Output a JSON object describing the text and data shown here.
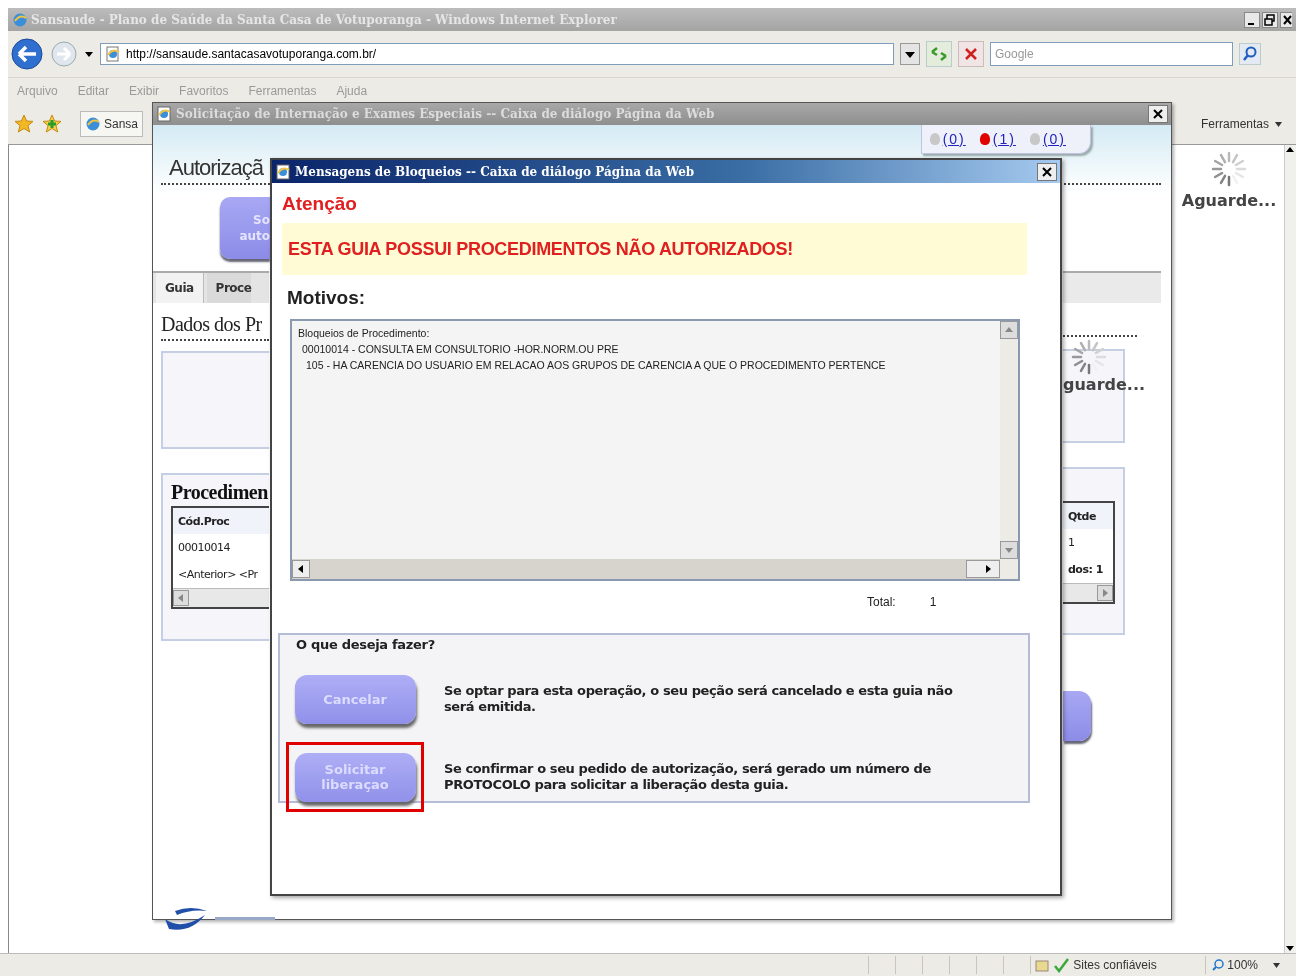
{
  "browser": {
    "title": "Sansaude - Plano de Saúde da Santa Casa de Votuporanga - Windows Internet Explorer",
    "address": "http://sansaude.santacasavotuporanga.com.br/",
    "search_placeholder": "Google",
    "menu": [
      "Arquivo",
      "Editar",
      "Exibir",
      "Favoritos",
      "Ferramentas",
      "Ajuda"
    ],
    "tab_label": "Sansa",
    "tools_label": "Ferramentas",
    "page_spinner_text": "Aguarde...",
    "status_bar": {
      "zone": "Sites confiáveis",
      "zoom": "100%"
    }
  },
  "outer_dialog": {
    "title": "Solicitação de Internação e Exames Especiais -- Caixa de diálogo Página da Web",
    "heading": "Autorizaçã",
    "indicators": [
      {
        "count": "(0)",
        "color": "#c8c8c8"
      },
      {
        "count": "(1)",
        "color": "#e00000"
      },
      {
        "count": "(0)",
        "color": "#c8c8c8"
      }
    ],
    "request_button": "So auto",
    "tabs": [
      {
        "label": "Guia",
        "selected": true
      },
      {
        "label": "Proce",
        "selected": false
      }
    ],
    "section_title": "Dados dos Pr",
    "spinner_text": "guarde...",
    "procedures": {
      "title": "Procedimen",
      "columns": [
        "Cód.Proc",
        "Qtde"
      ],
      "row": [
        "00010014",
        "1"
      ],
      "pager": "<Anterior> <Pr",
      "results": "dos: 1"
    }
  },
  "dialog": {
    "title": "Mensagens de Bloqueios -- Caixa de diálogo Página da Web",
    "attention": "Atenção",
    "alert": "ESTA GUIA POSSUI PROCEDIMENTOS NÃO AUTORIZADOS!",
    "reasons_label": "Motivos:",
    "reasons": [
      "Bloqueios de Procedimento:",
      "00010014 - CONSULTA EM CONSULTORIO -HOR.NORM.OU PRE",
      "105 - HA CARENCIA DO USUARIO EM RELACAO AOS GRUPOS DE CARENCIA A QUE O PROCEDIMENTO PERTENCE"
    ],
    "total_label": "Total:",
    "total": "1",
    "question": "O que deseja fazer?",
    "actions": [
      {
        "label": "Cancelar",
        "description": "Se optar para esta operação, o seu peção será cancelado e esta guia não será emitida.",
        "highlighted": false
      },
      {
        "label": "Solicitar liberaçao",
        "description": "Se confirmar o seu pedido de autorização, será gerado um número de PROTOCOLO para solicitar a liberação desta guia.",
        "highlighted": true
      }
    ]
  }
}
